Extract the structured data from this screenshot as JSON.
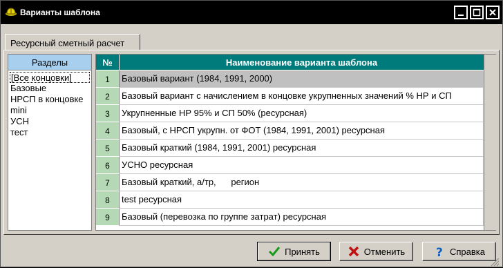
{
  "window": {
    "title": "Варианты шаблона"
  },
  "tabs": [
    {
      "label": "Ресурсный сметный расчет"
    }
  ],
  "sections": {
    "header": "Разделы",
    "items": [
      {
        "label": "[Все концовки]",
        "selected": true
      },
      {
        "label": "Базовые"
      },
      {
        "label": "НРСП в концовке"
      },
      {
        "label": "mini"
      },
      {
        "label": "УСН"
      },
      {
        "label": "тест"
      }
    ]
  },
  "grid": {
    "columns": {
      "no": "№",
      "name": "Наименование варианта шаблона"
    },
    "rows": [
      {
        "no": "1",
        "name": "Базовый вариант (1984, 1991, 2000)",
        "selected": true
      },
      {
        "no": "2",
        "name": "Базовый вариант с начислением в концовке укрупненных значений % НР и СП"
      },
      {
        "no": "3",
        "name": "Укрупненные НР 95% и СП 50% (ресурсная)"
      },
      {
        "no": "4",
        "name": "Базовый, с НРСП укрупн. от ФОТ (1984, 1991, 2001) ресурсная"
      },
      {
        "no": "5",
        "name": "Базовый краткий (1984, 1991, 2001) ресурсная"
      },
      {
        "no": "6",
        "name": "УСНО ресурсная"
      },
      {
        "no": "7",
        "name": "Базовый краткий, а/тр,      регион"
      },
      {
        "no": "8",
        "name": "test ресурсная"
      },
      {
        "no": "9",
        "name": "Базовый (перевозка по группе затрат) ресурсная"
      }
    ]
  },
  "buttons": {
    "ok": "Принять",
    "cancel": "Отменить",
    "help": "Справка"
  },
  "colors": {
    "header_bg": "#007b7b",
    "row_number_bg": "#b5d8b5",
    "sections_header_bg": "#a9cfee"
  }
}
